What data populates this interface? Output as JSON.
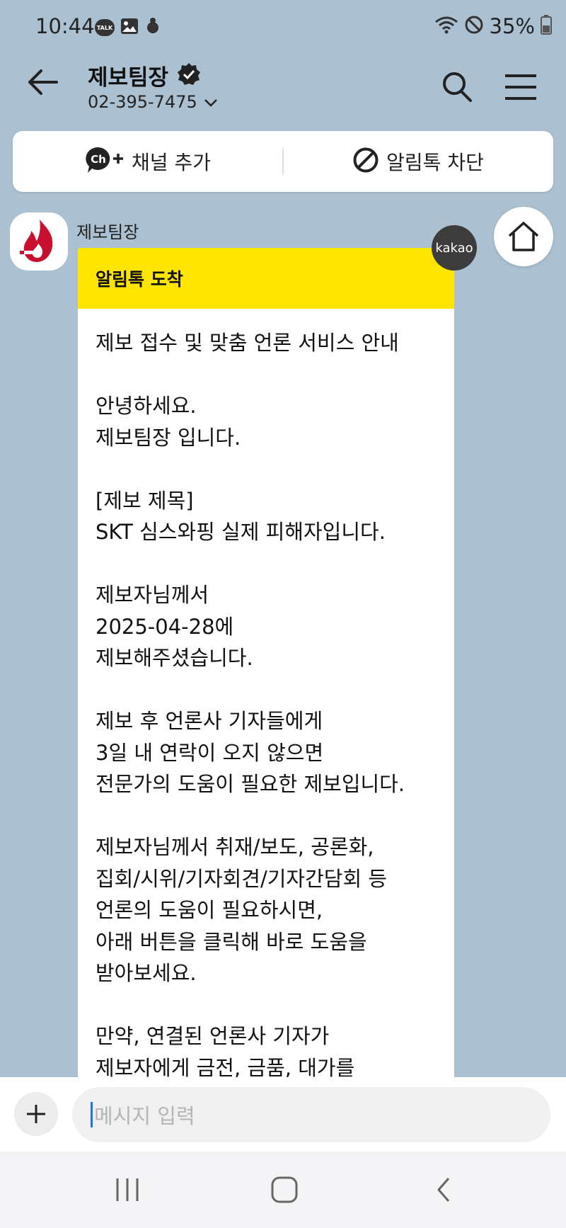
{
  "status_bar": {
    "time": "10:44",
    "talk_label": "TALK",
    "battery": "35%"
  },
  "header": {
    "title": "제보팀장",
    "phone": "02-395-7475"
  },
  "channel_actions": {
    "add_channel": "채널 추가",
    "ch_label": "Ch",
    "block": "알림톡 차단"
  },
  "message": {
    "sender": "제보팀장",
    "badge": "kakao",
    "header": "알림톡 도착",
    "body": "제보 접수 및 맞춤 언론 서비스 안내\n\n안녕하세요.\n제보팀장 입니다.\n\n[제보 제목]\nSKT 심스와핑 실제 피해자입니다.\n\n제보자님께서\n2025-04-28에\n제보해주셨습니다.\n\n제보 후 언론사 기자들에게\n3일 내 연락이 오지 않으면\n전문가의 도움이 필요한 제보입니다.\n\n제보자님께서 취재/보도, 공론화,\n집회/시위/기자회견/기자간담회 등\n언론의 도움이 필요하시면,\n아래 버튼을 클릭해 바로 도움을\n받아보세요.\n\n만약, 연결된 언론사 기자가\n제보자에게 금전, 금품, 대가를"
  },
  "input": {
    "placeholder": "메시지 입력"
  },
  "colors": {
    "background": "#abc1d1",
    "alimtalk_yellow": "#fee500",
    "brand_red": "#c8102e"
  }
}
